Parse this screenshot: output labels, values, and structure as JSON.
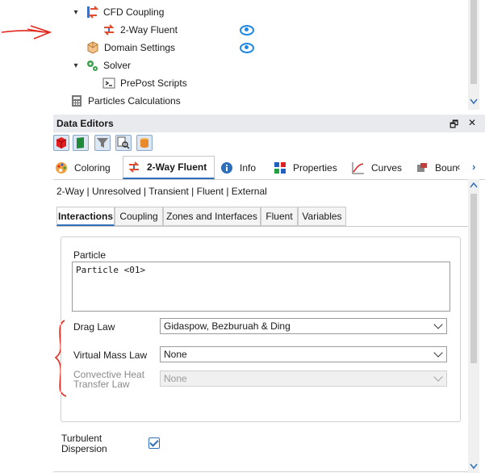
{
  "tree": {
    "cfd_coupling": "CFD Coupling",
    "two_way_fluent": "2-Way Fluent",
    "domain_settings": "Domain Settings",
    "solver": "Solver",
    "prepost_scripts": "PrePost Scripts",
    "particles_calculations": "Particles Calculations"
  },
  "panel": {
    "title": "Data Editors",
    "restore_glyph": "🗗",
    "close_glyph": "✕"
  },
  "tabs": [
    {
      "label": "Coloring"
    },
    {
      "label": "2-Way Fluent"
    },
    {
      "label": "Info"
    },
    {
      "label": "Properties"
    },
    {
      "label": "Curves"
    },
    {
      "label": "Boun"
    }
  ],
  "summary": "2-Way | Unresolved | Transient | Fluent | External",
  "subtabs": [
    "Interactions",
    "Coupling",
    "Zones and Interfaces",
    "Fluent",
    "Variables"
  ],
  "form": {
    "particle_label": "Particle",
    "particle_item": "Particle <01>",
    "drag_law_label": "Drag Law",
    "drag_law_value": "Gidaspow, Bezburuah & Ding",
    "virtual_mass_label": "Virtual Mass Law",
    "virtual_mass_value": "None",
    "convective_label_1": "Convective Heat",
    "convective_label_2": "Transfer Law",
    "convective_value": "None",
    "turbulent_label_1": "Turbulent",
    "turbulent_label_2": "Dispersion",
    "turbulent_checked": true
  },
  "colors": {
    "accent": "#2f6fba",
    "annotation": "#e0281e",
    "eye": "#1e88e5"
  }
}
